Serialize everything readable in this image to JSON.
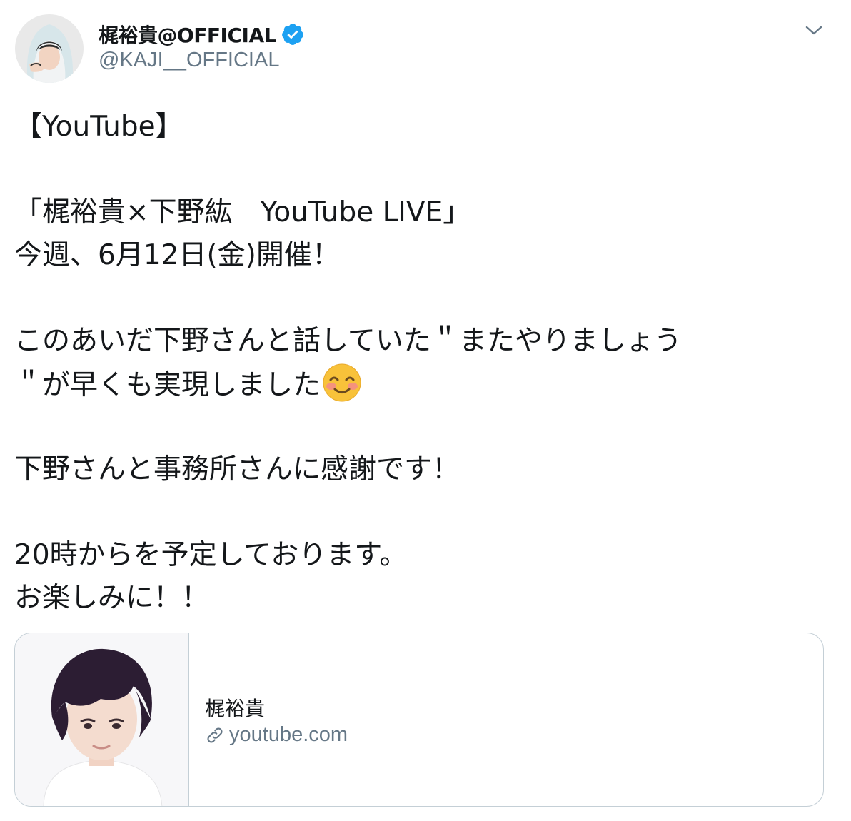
{
  "author": {
    "display_name": "梶裕貴@OFFICIAL",
    "handle": "@KAJI__OFFICIAL",
    "verified": true
  },
  "tweet": {
    "lines": [
      "【YouTube】",
      "",
      "「梶裕貴×下野紘　YouTube LIVE」",
      "今週、6月12日(金)開催！",
      "",
      "このあいだ下野さんと話していた＂またやりましょう",
      "＂が早くも実現しました",
      "",
      "下野さんと事務所さんに感謝です！",
      "",
      "20時からを予定しております。",
      "お楽しみに！！"
    ],
    "emoji": "smiling-face-with-smiling-eyes"
  },
  "card": {
    "title": "梶裕貴",
    "domain": "youtube.com"
  },
  "colors": {
    "text": "#14171a",
    "secondary": "#657786",
    "verified": "#1da1f2",
    "border": "#c4cfd6"
  },
  "icons": {
    "verified": "verified-badge-icon",
    "menu": "chevron-down-icon",
    "link": "link-icon"
  }
}
